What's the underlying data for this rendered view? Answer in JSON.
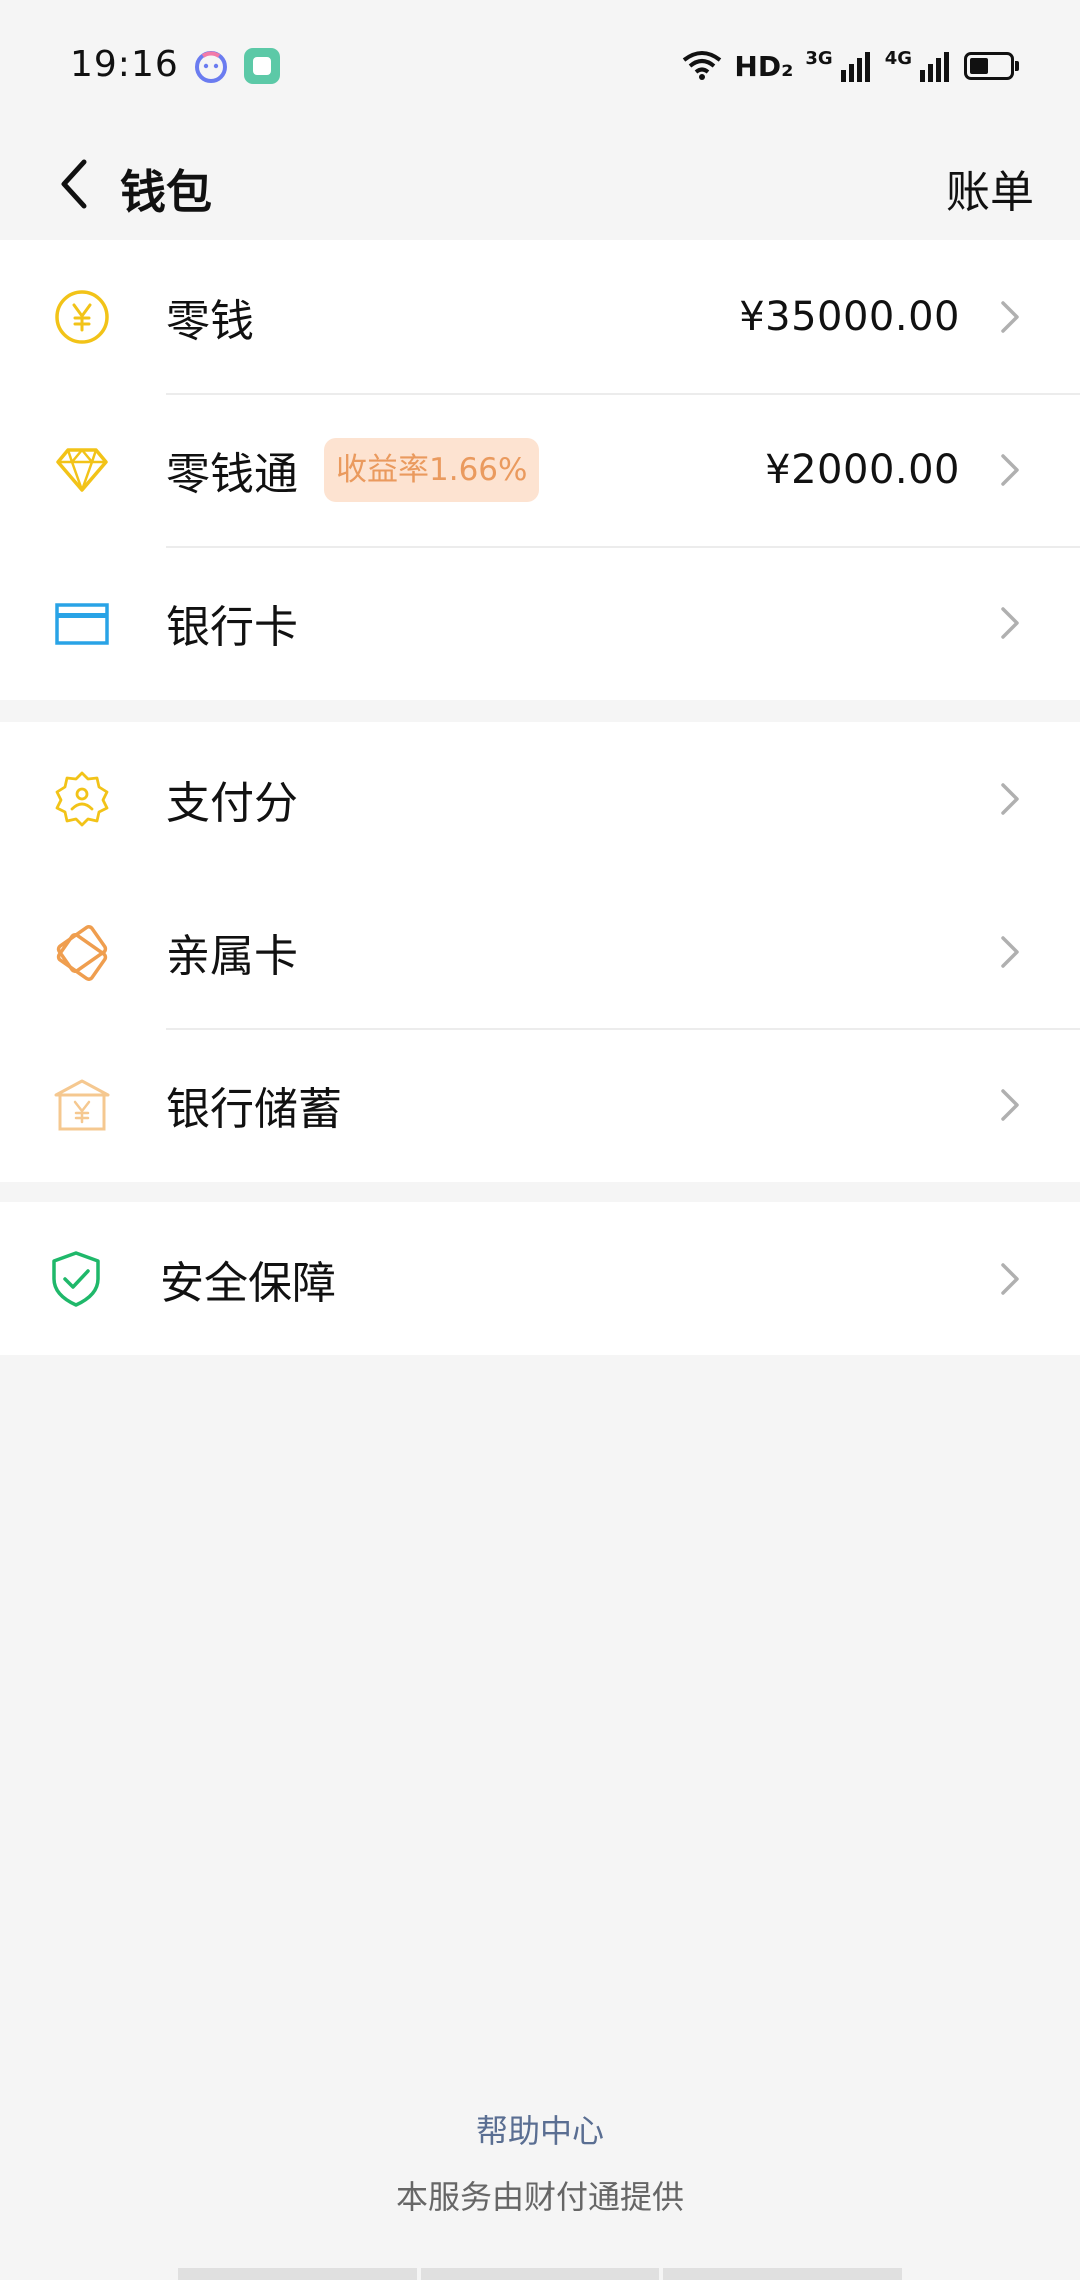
{
  "status_bar": {
    "time": "19:16",
    "network_hd": "HD₂",
    "net1": "3G",
    "net2": "4G",
    "icons": [
      "chat-app-icon",
      "cloud-app-icon",
      "wifi-icon",
      "signal-icon",
      "battery-icon"
    ]
  },
  "header": {
    "title": "钱包",
    "right_action": "账单"
  },
  "groups": [
    {
      "items": [
        {
          "label": "零钱",
          "amount": "¥35000.00",
          "icon": "yuan-coin-icon"
        },
        {
          "label": "零钱通",
          "badge": "收益率1.66%",
          "amount": "¥2000.00",
          "icon": "diamond-icon"
        },
        {
          "label": "银行卡",
          "icon": "bank-card-icon"
        }
      ]
    },
    {
      "items": [
        {
          "label": "支付分",
          "icon": "credit-score-icon"
        },
        {
          "label": "亲属卡",
          "icon": "family-card-icon"
        },
        {
          "label": "银行储蓄",
          "icon": "bank-savings-icon"
        }
      ]
    },
    {
      "items": [
        {
          "label": "安全保障",
          "icon": "security-shield-icon"
        }
      ]
    }
  ],
  "footer": {
    "help": "帮助中心",
    "provider": "本服务由财付通提供"
  },
  "colors": {
    "coin_yellow": "#f2c318",
    "card_blue": "#29a3e6",
    "orange": "#ef9e4f",
    "shield_green": "#1fb86a",
    "badge_bg": "#fde3d1",
    "badge_text": "#ea9a5e",
    "help_link": "#5a6e92"
  }
}
